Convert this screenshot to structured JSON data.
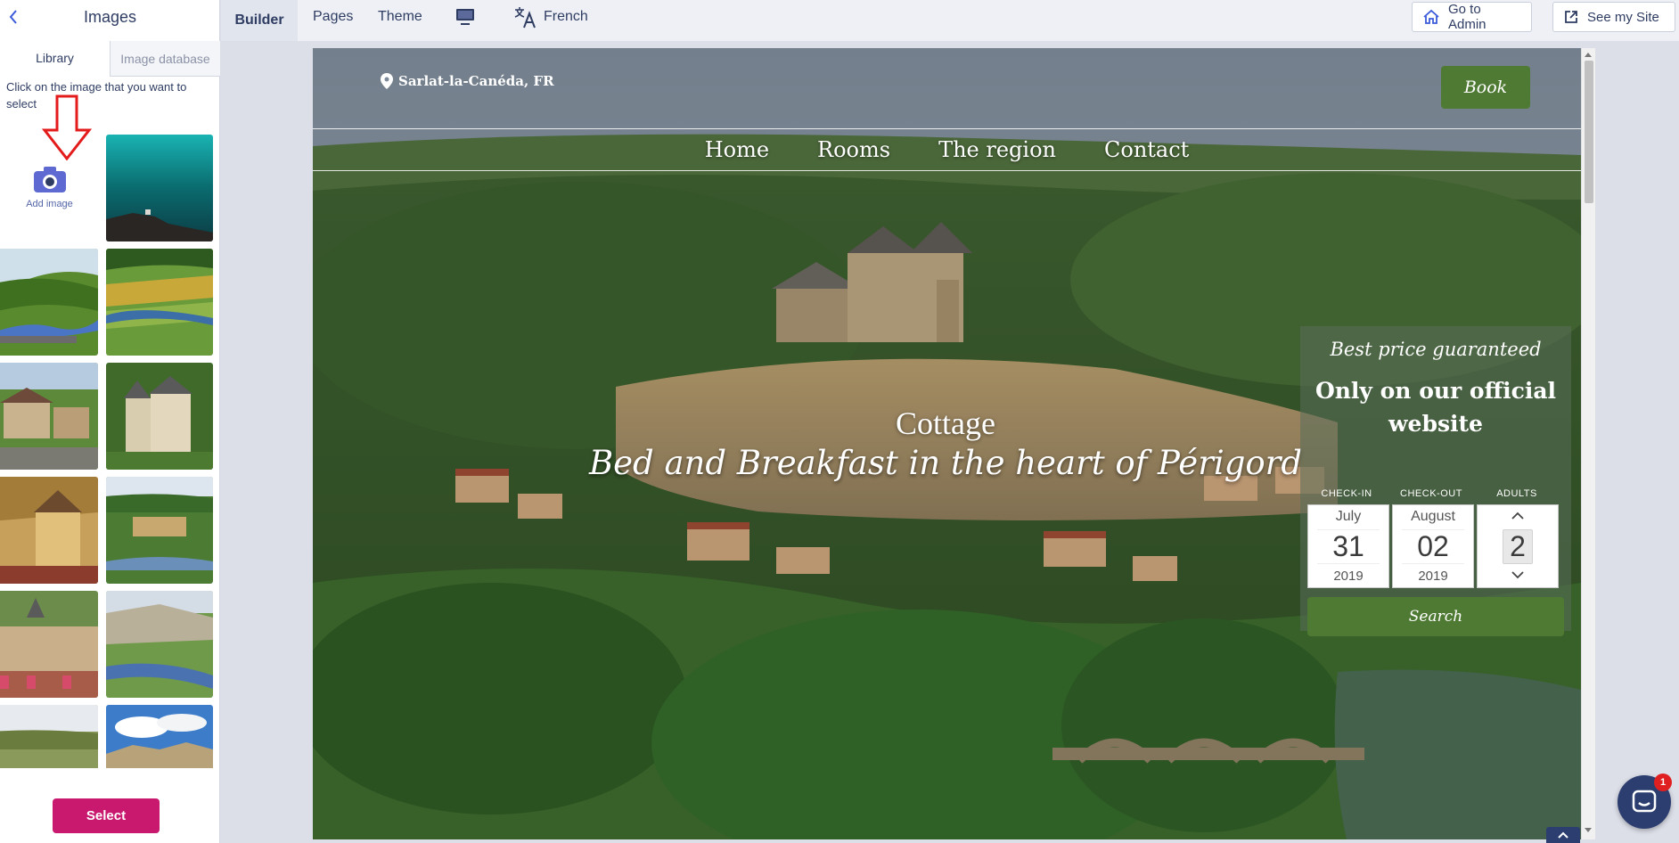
{
  "panel": {
    "title": "Images",
    "tabs": [
      {
        "label": "Library",
        "active": true
      },
      {
        "label": "Image database",
        "active": false
      }
    ],
    "hint": "Click on the image that you want to select",
    "add_image_label": "Add image",
    "select_label": "Select"
  },
  "toolbar": {
    "builder": "Builder",
    "pages": "Pages",
    "theme": "Theme",
    "language": "French",
    "go_to_admin": "Go to Admin",
    "see_my_site": "See my Site"
  },
  "site": {
    "location": "Sarlat-la-Canéda, FR",
    "book": "Book",
    "nav": [
      "Home",
      "Rooms",
      "The region",
      "Contact"
    ],
    "hero_title": "Cottage",
    "hero_tagline": "Bed and Breakfast in the heart of Périgord",
    "booking": {
      "promo": "Best price guaranteed",
      "official": "Only on our official website",
      "checkin_label": "CHECK-IN",
      "checkout_label": "CHECK-OUT",
      "adults_label": "ADULTS",
      "checkin": {
        "month": "July",
        "day": "31",
        "year": "2019"
      },
      "checkout": {
        "month": "August",
        "day": "02",
        "year": "2019"
      },
      "adults": "2",
      "search": "Search"
    }
  },
  "chat": {
    "badge": "1"
  },
  "colors": {
    "accent_green": "#4f7a33",
    "select_pink": "#c8196e",
    "navy": "#2c3e70"
  }
}
